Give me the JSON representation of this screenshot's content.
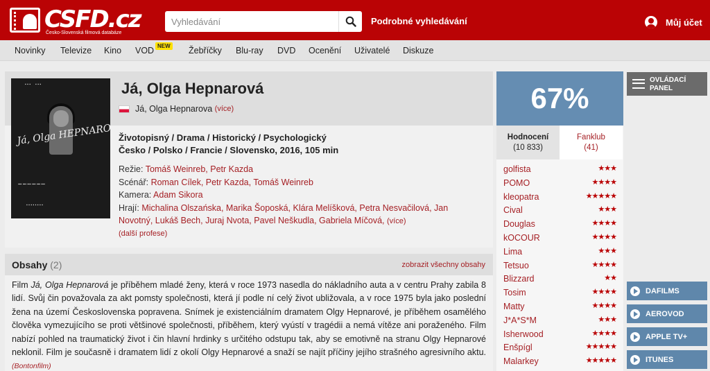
{
  "header": {
    "logo_word": "CSFD.cz",
    "logo_tagline": "Česko-Slovenská filmová databáze",
    "search_placeholder": "Vyhledávání",
    "advanced_search": "Podrobné vyhledávání",
    "account": "Můj účet"
  },
  "nav": {
    "items": [
      "Novinky",
      "Televize",
      "Kino",
      "VOD",
      "Žebříčky",
      "Blu-ray",
      "DVD",
      "Ocenění",
      "Uživatelé",
      "Diskuze"
    ],
    "new_badge": "NEW"
  },
  "film": {
    "title": "Já, Olga Hepnarová",
    "original_title": "Já, Olga Hepnarova",
    "more": "(více)",
    "genres": "Životopisný / Drama / Historický / Psychologický",
    "origin": "Česko / Polsko / Francie / Slovensko, 2016, 105 min",
    "director_label": "Režie:",
    "director": "Tomáš Weinreb, Petr Kazda",
    "writer_label": "Scénář:",
    "writer": "Roman Cílek, Petr Kazda, Tomáš Weinreb",
    "camera_label": "Kamera:",
    "camera": "Adam Sikora",
    "cast_label": "Hrají:",
    "cast_line1": "Michalina Olszańska, Marika Šoposká, Klára Melíšková, Petra Nesvačilová, Jan",
    "cast_line2": "Novotný, Lukáš Bech, Juraj Nvota, Pavel Neškudla, Gabriela Míčová,",
    "cast_more": "(více)",
    "more_professions": "(další profese)",
    "poster_signature": "Já, Olga HEPNAROVÁ"
  },
  "plot": {
    "heading": "Obsahy",
    "count": "(2)",
    "show_all": "zobrazit všechny obsahy",
    "text_before_title": "Film ",
    "text_title": "Já, Olga Hepnarová",
    "text": " je příběhem mladé ženy, která v roce 1973 nasedla do nákladního auta a v centru Prahy zabila 8 lidí. Svůj čin považovala za akt pomsty společnosti, která jí podle ní celý život ubližovala, a v roce 1975 byla jako poslední žena na území Československa popravena. Snímek je existenciálním dramatem Olgy Hepnarové, je příběhem osamělého člověka vymezujícího se proti většinové společnosti, příběhem, který vyústí v tragédii a nemá vítěze ani poraženého. Film nabízí pohled na traumatický život i čin hlavní hrdinky s určitého odstupu tak, aby se emotivně na stranu Olgy Hepnarové neklonil. Film je současně i dramatem lidí z okolí Olgy Hepnarové a snaží se najít příčiny jejího strašného agresivního aktu.",
    "source": "(Bontonfilm)"
  },
  "rating": {
    "score": "67%",
    "tab_rating_label": "Hodnocení",
    "tab_rating_count": "(10 833)",
    "tab_fan_label": "Fanklub",
    "tab_fan_count": "(41)",
    "users": [
      {
        "name": "golfista",
        "stars": "★★★"
      },
      {
        "name": "POMO",
        "stars": "★★★★"
      },
      {
        "name": "kleopatra",
        "stars": "★★★★★"
      },
      {
        "name": "Cival",
        "stars": "★★★"
      },
      {
        "name": "Douglas",
        "stars": "★★★★"
      },
      {
        "name": "kOCOUR",
        "stars": "★★★★"
      },
      {
        "name": "Lima",
        "stars": "★★★"
      },
      {
        "name": "Tetsuo",
        "stars": "★★★★"
      },
      {
        "name": "Blizzard",
        "stars": "★★"
      },
      {
        "name": "Tosim",
        "stars": "★★★★"
      },
      {
        "name": "Matty",
        "stars": "★★★★"
      },
      {
        "name": "J*A*S*M",
        "stars": "★★★"
      },
      {
        "name": "Isherwood",
        "stars": "★★★★"
      },
      {
        "name": "Enšpígl",
        "stars": "★★★★★"
      },
      {
        "name": "Malarkey",
        "stars": "★★★★★"
      }
    ]
  },
  "side": {
    "panel_line1": "OVLÁDACÍ",
    "panel_line2": "PANEL",
    "vod": [
      "DAFILMS",
      "AEROVOD",
      "APPLE TV+",
      "ITUNES"
    ]
  }
}
